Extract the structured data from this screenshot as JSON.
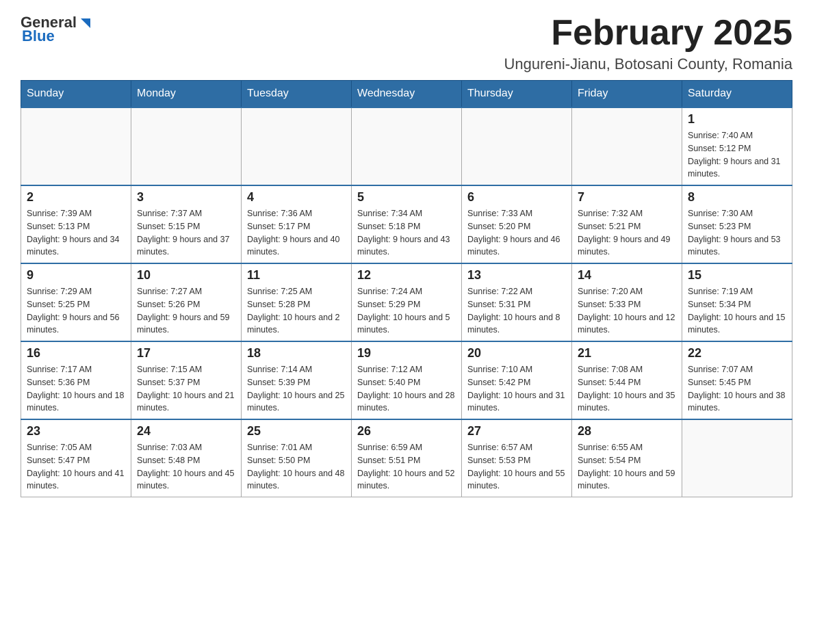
{
  "header": {
    "logo_general": "General",
    "logo_blue": "Blue",
    "month_title": "February 2025",
    "location": "Ungureni-Jianu, Botosani County, Romania"
  },
  "weekdays": [
    "Sunday",
    "Monday",
    "Tuesday",
    "Wednesday",
    "Thursday",
    "Friday",
    "Saturday"
  ],
  "weeks": [
    [
      {
        "day": "",
        "info": ""
      },
      {
        "day": "",
        "info": ""
      },
      {
        "day": "",
        "info": ""
      },
      {
        "day": "",
        "info": ""
      },
      {
        "day": "",
        "info": ""
      },
      {
        "day": "",
        "info": ""
      },
      {
        "day": "1",
        "info": "Sunrise: 7:40 AM\nSunset: 5:12 PM\nDaylight: 9 hours and 31 minutes."
      }
    ],
    [
      {
        "day": "2",
        "info": "Sunrise: 7:39 AM\nSunset: 5:13 PM\nDaylight: 9 hours and 34 minutes."
      },
      {
        "day": "3",
        "info": "Sunrise: 7:37 AM\nSunset: 5:15 PM\nDaylight: 9 hours and 37 minutes."
      },
      {
        "day": "4",
        "info": "Sunrise: 7:36 AM\nSunset: 5:17 PM\nDaylight: 9 hours and 40 minutes."
      },
      {
        "day": "5",
        "info": "Sunrise: 7:34 AM\nSunset: 5:18 PM\nDaylight: 9 hours and 43 minutes."
      },
      {
        "day": "6",
        "info": "Sunrise: 7:33 AM\nSunset: 5:20 PM\nDaylight: 9 hours and 46 minutes."
      },
      {
        "day": "7",
        "info": "Sunrise: 7:32 AM\nSunset: 5:21 PM\nDaylight: 9 hours and 49 minutes."
      },
      {
        "day": "8",
        "info": "Sunrise: 7:30 AM\nSunset: 5:23 PM\nDaylight: 9 hours and 53 minutes."
      }
    ],
    [
      {
        "day": "9",
        "info": "Sunrise: 7:29 AM\nSunset: 5:25 PM\nDaylight: 9 hours and 56 minutes."
      },
      {
        "day": "10",
        "info": "Sunrise: 7:27 AM\nSunset: 5:26 PM\nDaylight: 9 hours and 59 minutes."
      },
      {
        "day": "11",
        "info": "Sunrise: 7:25 AM\nSunset: 5:28 PM\nDaylight: 10 hours and 2 minutes."
      },
      {
        "day": "12",
        "info": "Sunrise: 7:24 AM\nSunset: 5:29 PM\nDaylight: 10 hours and 5 minutes."
      },
      {
        "day": "13",
        "info": "Sunrise: 7:22 AM\nSunset: 5:31 PM\nDaylight: 10 hours and 8 minutes."
      },
      {
        "day": "14",
        "info": "Sunrise: 7:20 AM\nSunset: 5:33 PM\nDaylight: 10 hours and 12 minutes."
      },
      {
        "day": "15",
        "info": "Sunrise: 7:19 AM\nSunset: 5:34 PM\nDaylight: 10 hours and 15 minutes."
      }
    ],
    [
      {
        "day": "16",
        "info": "Sunrise: 7:17 AM\nSunset: 5:36 PM\nDaylight: 10 hours and 18 minutes."
      },
      {
        "day": "17",
        "info": "Sunrise: 7:15 AM\nSunset: 5:37 PM\nDaylight: 10 hours and 21 minutes."
      },
      {
        "day": "18",
        "info": "Sunrise: 7:14 AM\nSunset: 5:39 PM\nDaylight: 10 hours and 25 minutes."
      },
      {
        "day": "19",
        "info": "Sunrise: 7:12 AM\nSunset: 5:40 PM\nDaylight: 10 hours and 28 minutes."
      },
      {
        "day": "20",
        "info": "Sunrise: 7:10 AM\nSunset: 5:42 PM\nDaylight: 10 hours and 31 minutes."
      },
      {
        "day": "21",
        "info": "Sunrise: 7:08 AM\nSunset: 5:44 PM\nDaylight: 10 hours and 35 minutes."
      },
      {
        "day": "22",
        "info": "Sunrise: 7:07 AM\nSunset: 5:45 PM\nDaylight: 10 hours and 38 minutes."
      }
    ],
    [
      {
        "day": "23",
        "info": "Sunrise: 7:05 AM\nSunset: 5:47 PM\nDaylight: 10 hours and 41 minutes."
      },
      {
        "day": "24",
        "info": "Sunrise: 7:03 AM\nSunset: 5:48 PM\nDaylight: 10 hours and 45 minutes."
      },
      {
        "day": "25",
        "info": "Sunrise: 7:01 AM\nSunset: 5:50 PM\nDaylight: 10 hours and 48 minutes."
      },
      {
        "day": "26",
        "info": "Sunrise: 6:59 AM\nSunset: 5:51 PM\nDaylight: 10 hours and 52 minutes."
      },
      {
        "day": "27",
        "info": "Sunrise: 6:57 AM\nSunset: 5:53 PM\nDaylight: 10 hours and 55 minutes."
      },
      {
        "day": "28",
        "info": "Sunrise: 6:55 AM\nSunset: 5:54 PM\nDaylight: 10 hours and 59 minutes."
      },
      {
        "day": "",
        "info": ""
      }
    ]
  ]
}
